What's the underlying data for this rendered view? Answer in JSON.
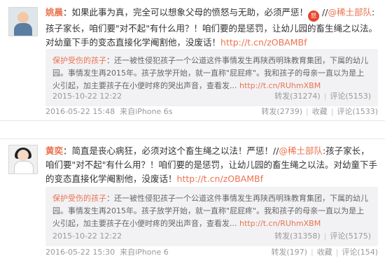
{
  "posts": [
    {
      "author": "姚晨",
      "text_part1": "：如果此事为真，完全可以想象父母的愤怒与无助，必须严惩！",
      "emoji": "怒",
      "text_part2": " //",
      "mention": "@稀土部队",
      "text_part3": ":孩子家长，咱们要\"对不起\"有什么用？！咱们要的是惩罚，让幼儿园的畜生绳之以法。对幼童下手的变态直接化学阉割他，没废话！",
      "link": "http://t.cn/zOBAMBf",
      "repost": {
        "author": "保护受伤的孩子",
        "text": "：还一被性侵犯孩子一个公道这件事情发生再陕西明珠教育集团，下属的幼儿园。事情发生再2015年。孩子放学开始，就一直称\"屁屁疼\"。我和孩子的母亲一直以为是上火引起，加主要孩子在小便时疼的哭出声音，查看发...",
        "link": "http://t.cn/RUhmXBM",
        "time": "2015-10-22 12:22",
        "forward": "转发(31274)",
        "comment": "评论(5153)"
      },
      "time": "2016-05-22 15:48",
      "source": "来自iPhone 6s",
      "forward": "转发(2739)",
      "favorite": "收藏",
      "comment": "评论(1533)"
    },
    {
      "author": "黄奕",
      "text_part1": "：简直是丧心病狂，必须对这个畜生绳之以法！严惩！//",
      "emoji": "",
      "text_part2": "",
      "mention": "@稀土部队",
      "text_part3": ":孩子家长，咱们要\"对不起\"有什么用？！咱们要的是惩罚，让幼儿园的畜生绳之以法。对幼童下手的变态直接化学阉割他，没废话！",
      "link": "http://t.cn/zOBAMBf",
      "repost": {
        "author": "保护受伤的孩子",
        "text": "：还一被性侵犯孩子一个公道这件事情发生再陕西明珠教育集团，下属的幼儿园。事情发生再2015年。孩子放学开始，就一直称\"屁屁疼\"。我和孩子的母亲一直以为是上火引起，加主要孩子在小便时疼的哭出声音，查看发...",
        "link": "http://t.cn/RUhmXBM",
        "time": "2015-10-22 12:22",
        "forward": "转发(31358)",
        "comment": "评论(5175)"
      },
      "time": "2016-05-22 15:30",
      "source": "来自iPhone 6",
      "forward": "转发(197)",
      "favorite": "收藏",
      "comment": "评论(154)"
    }
  ]
}
